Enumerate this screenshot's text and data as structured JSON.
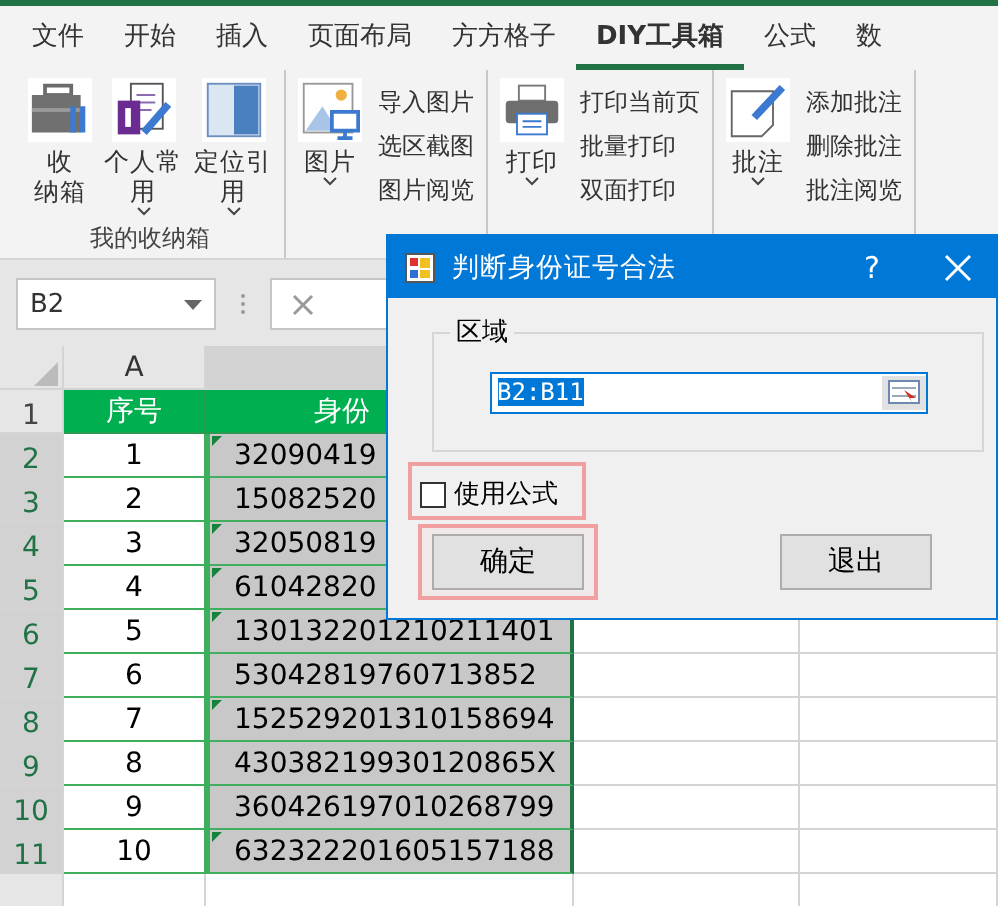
{
  "ribbon": {
    "tabs": [
      {
        "label": "文件",
        "selected": false
      },
      {
        "label": "开始",
        "selected": false
      },
      {
        "label": "插入",
        "selected": false
      },
      {
        "label": "页面布局",
        "selected": false
      },
      {
        "label": "方方格子",
        "selected": false
      },
      {
        "label": "DIY工具箱",
        "selected": true
      },
      {
        "label": "公式",
        "selected": false
      },
      {
        "label": "数",
        "selected": false
      }
    ],
    "groups": [
      {
        "label": "我的收纳箱",
        "big": [
          {
            "kind": "toolbox",
            "label": [
              "收",
              "纳箱"
            ]
          },
          {
            "kind": "notes",
            "label": [
              "个人常",
              "用"
            ],
            "dropdown": true
          },
          {
            "kind": "panel",
            "label": [
              "定位引",
              "用"
            ],
            "dropdown": true
          }
        ]
      },
      {
        "big": [
          {
            "kind": "image",
            "label": [
              "图片"
            ],
            "dropdown": true
          }
        ],
        "small": [
          "导入图片",
          "选区截图",
          "图片阅览"
        ]
      },
      {
        "big": [
          {
            "kind": "printer",
            "label": [
              "打印"
            ],
            "dropdown": true
          }
        ],
        "small": [
          "打印当前页",
          "批量打印",
          "双面打印"
        ]
      },
      {
        "big": [
          {
            "kind": "comment",
            "label": [
              "批注"
            ],
            "dropdown": true
          }
        ],
        "small": [
          "添加批注",
          "删除批注",
          "批注阅览"
        ]
      }
    ]
  },
  "formula_bar": {
    "name_box": "B2"
  },
  "sheet": {
    "column_headers": [
      "A"
    ],
    "header_row": {
      "row": "1",
      "cells": [
        "序号",
        "身份"
      ]
    },
    "rows": [
      {
        "row": "2",
        "index": "1",
        "id": "32090419",
        "error_flag": true
      },
      {
        "row": "3",
        "index": "2",
        "id": "15082520",
        "error_flag": false
      },
      {
        "row": "4",
        "index": "3",
        "id": "32050819",
        "error_flag": true
      },
      {
        "row": "5",
        "index": "4",
        "id": "61042820",
        "error_flag": true
      },
      {
        "row": "6",
        "index": "5",
        "id": "130132201210211401",
        "error_flag": true
      },
      {
        "row": "7",
        "index": "6",
        "id": "53042819760713852",
        "error_flag": false
      },
      {
        "row": "8",
        "index": "7",
        "id": "152529201310158694",
        "error_flag": true
      },
      {
        "row": "9",
        "index": "8",
        "id": "43038219930120865X",
        "error_flag": false
      },
      {
        "row": "10",
        "index": "9",
        "id": "360426197010268799",
        "error_flag": false
      },
      {
        "row": "11",
        "index": "10",
        "id": "632322201605157188",
        "error_flag": true
      }
    ]
  },
  "dialog": {
    "title": "判断身份证号合法",
    "help": "?",
    "range_group": {
      "label": "区域",
      "value": "B2:B11"
    },
    "use_formula": {
      "label": "使用公式",
      "checked": false,
      "highlighted": true
    },
    "buttons": [
      {
        "label": "确定",
        "highlighted": true
      },
      {
        "label": "退出",
        "highlighted": false
      }
    ]
  }
}
